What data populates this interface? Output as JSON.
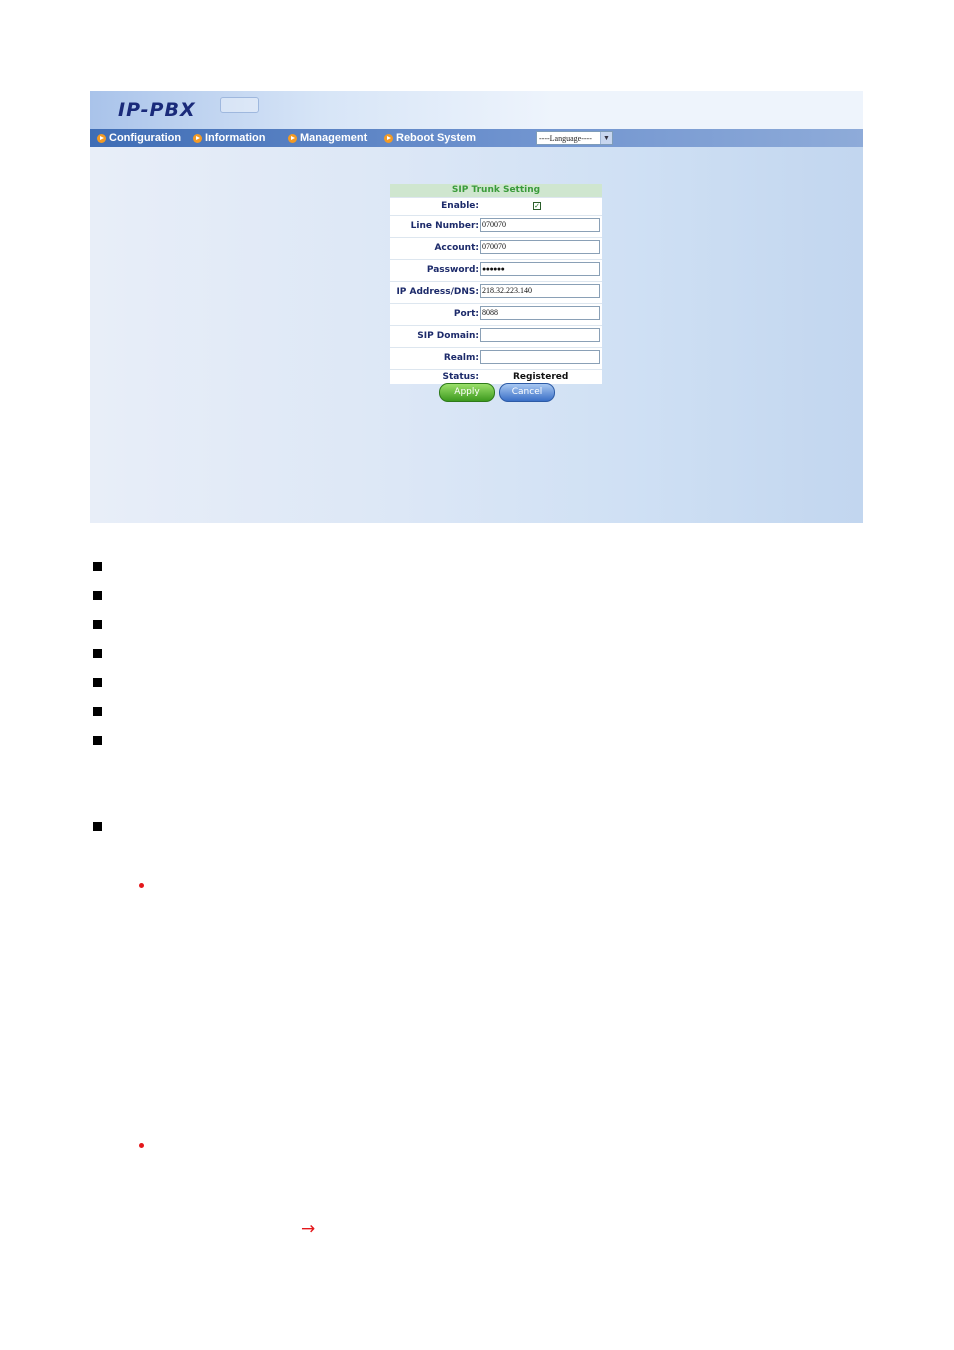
{
  "app": {
    "logo": "IP-PBX",
    "nav": [
      "Configuration",
      "Information",
      "Management",
      "Reboot System"
    ],
    "language_select": "----Language----"
  },
  "form": {
    "title": "SIP Trunk Setting",
    "enable_label": "Enable:",
    "enable_checked": true,
    "line_number_label": "Line Number:",
    "line_number_value": "070070",
    "account_label": "Account:",
    "account_value": "070070",
    "password_label": "Password:",
    "password_value": "●●●●●●",
    "ip_label": "IP Address/DNS:",
    "ip_value": "218.32.223.140",
    "port_label": "Port:",
    "port_value": "8088",
    "sip_domain_label": "SIP Domain:",
    "sip_domain_value": "",
    "realm_label": "Realm:",
    "realm_value": "",
    "status_label": "Status:",
    "status_value": "Registered",
    "apply_label": "Apply",
    "cancel_label": "Cancel"
  },
  "doc": {
    "arrow": "→"
  }
}
